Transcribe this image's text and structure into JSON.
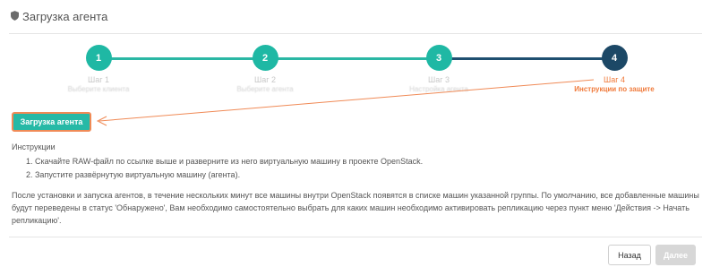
{
  "header": {
    "title": "Загрузка агента",
    "icon": "shield-icon"
  },
  "stepper": {
    "steps": [
      {
        "number": "1",
        "title": "Шаг 1",
        "description": "Выберите клиента",
        "state": "done"
      },
      {
        "number": "2",
        "title": "Шаг 2",
        "description": "Выберите агента",
        "state": "done"
      },
      {
        "number": "3",
        "title": "Шаг 3",
        "description": "Настройка агента",
        "state": "done"
      },
      {
        "number": "4",
        "title": "Шаг 4",
        "description": "Инструкции по защите",
        "state": "active"
      }
    ]
  },
  "main": {
    "agent_button_label": "Загрузка агента",
    "instructions_heading": "Инструкции",
    "instructions": [
      "Скачайте RAW-файл по ссылке выше и разверните из него виртуальную машину в проекте OpenStack.",
      "Запустите развёрнутую виртуальную машину (агента)."
    ],
    "paragraph": "После установки и запуска агентов, в течение нескольких минут все машины внутри OpenStack появятся в списке машин указанной группы. По умолчанию, все добавленные машины будут переведены в статус 'Обнаружено', Вам необходимо самостоятельно выбрать для каких машин необходимо активировать репликацию через пункт меню 'Действия -> Начать репликацию'."
  },
  "footer": {
    "back_label": "Назад",
    "next_label": "Далее"
  },
  "colors": {
    "accent": "#1fb8a4",
    "active_step": "#1c4866",
    "annotation": "#f07a3b"
  }
}
